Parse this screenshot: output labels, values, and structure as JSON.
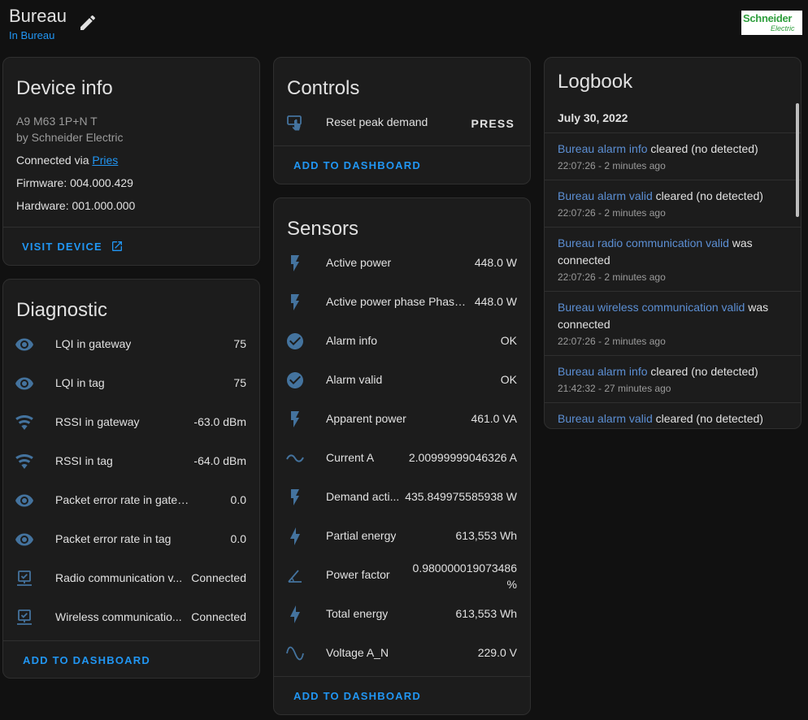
{
  "header": {
    "title": "Bureau",
    "area": "In Bureau",
    "logo": {
      "line1": "Schneider",
      "line2": "Electric"
    }
  },
  "device_info": {
    "title": "Device info",
    "model": "A9 M63 1P+N T",
    "manufacturer": "by Schneider Electric",
    "connected_prefix": "Connected via ",
    "connected_link": "Pries",
    "firmware": "Firmware: 004.000.429",
    "hardware": "Hardware: 001.000.000",
    "visit_label": "VISIT DEVICE"
  },
  "diagnostic": {
    "title": "Diagnostic",
    "items": [
      {
        "icon": "eye-icon",
        "label": "LQI in gateway",
        "value": "75"
      },
      {
        "icon": "eye-icon",
        "label": "LQI in tag",
        "value": "75"
      },
      {
        "icon": "wifi-icon",
        "label": "RSSI in gateway",
        "value": "-63.0 dBm"
      },
      {
        "icon": "wifi-icon",
        "label": "RSSI in tag",
        "value": "-64.0 dBm"
      },
      {
        "icon": "eye-icon",
        "label": "Packet error rate in gateway",
        "value": "0.0"
      },
      {
        "icon": "eye-icon",
        "label": "Packet error rate in tag",
        "value": "0.0"
      },
      {
        "icon": "network-icon",
        "label": "Radio communication v...",
        "value": "Connected"
      },
      {
        "icon": "network-icon",
        "label": "Wireless communicatio...",
        "value": "Connected"
      }
    ],
    "add_label": "ADD TO DASHBOARD"
  },
  "controls": {
    "title": "Controls",
    "item": {
      "icon": "gesture-tap-icon",
      "label": "Reset peak demand",
      "action": "PRESS"
    },
    "add_label": "ADD TO DASHBOARD"
  },
  "sensors": {
    "title": "Sensors",
    "items": [
      {
        "icon": "flash-icon",
        "label": "Active power",
        "value": "448.0 W"
      },
      {
        "icon": "flash-icon",
        "label": "Active power phase Phase...",
        "value": "448.0 W"
      },
      {
        "icon": "check-circle-icon",
        "label": "Alarm info",
        "value": "OK"
      },
      {
        "icon": "check-circle-icon",
        "label": "Alarm valid",
        "value": "OK"
      },
      {
        "icon": "flash-icon",
        "label": "Apparent power",
        "value": "461.0 VA"
      },
      {
        "icon": "current-ac-icon",
        "label": "Current A",
        "value": "2.00999999046326 A"
      },
      {
        "icon": "flash-icon",
        "label": "Demand acti...",
        "value": "435.849975585938 W"
      },
      {
        "icon": "lightning-bolt-icon",
        "label": "Partial energy",
        "value": "613,553 Wh"
      },
      {
        "icon": "angle-acute-icon",
        "label": "Power factor",
        "value": "0.980000019073486",
        "value2": "%"
      },
      {
        "icon": "lightning-bolt-icon",
        "label": "Total energy",
        "value": "613,553 Wh"
      },
      {
        "icon": "sine-wave-icon",
        "label": "Voltage A_N",
        "value": "229.0 V"
      }
    ],
    "add_label": "ADD TO DASHBOARD"
  },
  "logbook": {
    "title": "Logbook",
    "date": "July 30, 2022",
    "entries": [
      {
        "entity": "Bureau alarm info",
        "text": " cleared (no detected)",
        "time": "22:07:26 - 2 minutes ago"
      },
      {
        "entity": "Bureau alarm valid",
        "text": " cleared (no detected)",
        "time": "22:07:26 - 2 minutes ago"
      },
      {
        "entity": "Bureau radio communication valid",
        "text": " was connected",
        "time": "22:07:26 - 2 minutes ago"
      },
      {
        "entity": "Bureau wireless communication valid",
        "text": " was connected",
        "time": "22:07:26 - 2 minutes ago"
      },
      {
        "entity": "Bureau alarm info",
        "text": " cleared (no detected)",
        "time": "21:42:32 - 27 minutes ago"
      },
      {
        "entity": "Bureau alarm valid",
        "text": " cleared (no detected)",
        "time": ""
      }
    ]
  },
  "colors": {
    "accent": "#2196f3",
    "icon": "#44739e",
    "card": "#1c1c1c",
    "background": "#111111"
  }
}
